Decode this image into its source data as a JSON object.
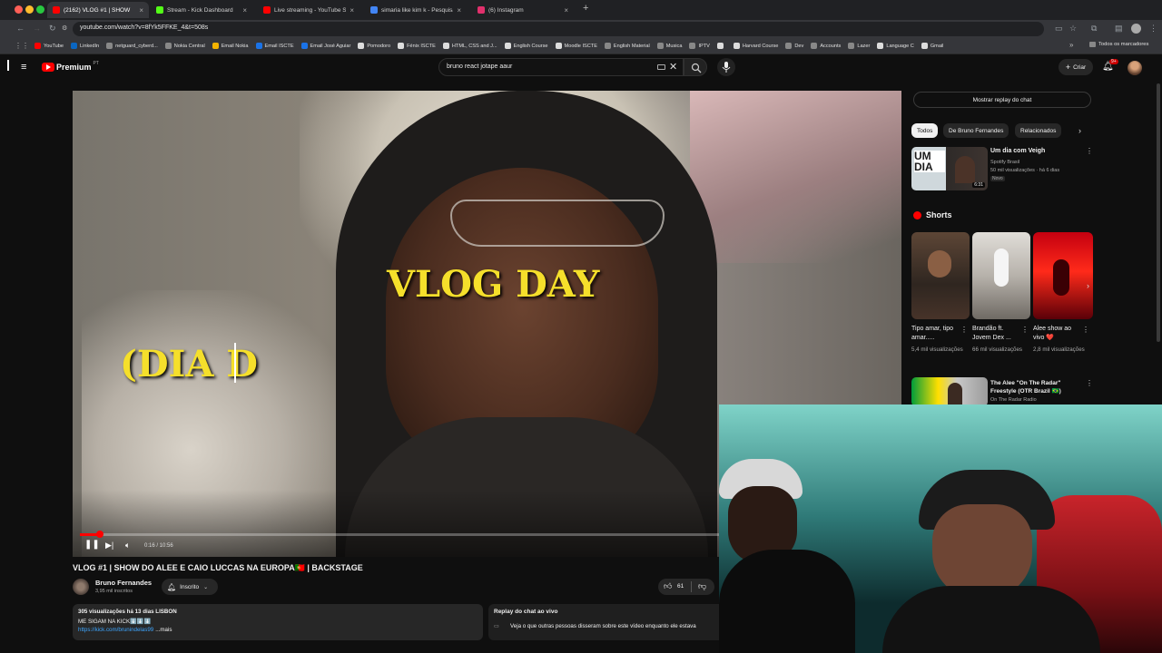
{
  "browser": {
    "tabs": [
      {
        "label": "(2162) VLOG #1 | SHOW",
        "color": "#ff0000",
        "active": true
      },
      {
        "label": "Stream - Kick Dashboard",
        "color": "#53fc18"
      },
      {
        "label": "Live streaming - YouTube St",
        "color": "#ff0000"
      },
      {
        "label": "simaria like kim k - Pesquisa",
        "color": "#4285f4"
      },
      {
        "label": "(6) Instagram",
        "color": "#e1306c"
      }
    ],
    "url": "youtube.com/watch?v=8fYk5FFKE_4&t=508s",
    "bookmarks": [
      {
        "label": "YouTube",
        "color": "#ff0000"
      },
      {
        "label": "LinkedIn",
        "color": "#0a66c2"
      },
      {
        "label": "netguard_cyberd...",
        "color": "#888888"
      },
      {
        "label": "Nokia Central",
        "color": "#888888"
      },
      {
        "label": "Email Nokia",
        "color": "#f4b400"
      },
      {
        "label": "Email ISCTE",
        "color": "#1a73e8"
      },
      {
        "label": "Email José Aguiar",
        "color": "#1a73e8"
      },
      {
        "label": "Pomodoro",
        "color": "#dddddd"
      },
      {
        "label": "Fénix ISCTE",
        "color": "#dddddd"
      },
      {
        "label": "HTML, CSS and J...",
        "color": "#dddddd"
      },
      {
        "label": "English Course",
        "color": "#dddddd"
      },
      {
        "label": "Moodle ISCTE",
        "color": "#dddddd"
      },
      {
        "label": "English Material",
        "color": "#888888"
      },
      {
        "label": "Musica",
        "color": "#888888"
      },
      {
        "label": "IPTV",
        "color": "#888888"
      },
      {
        "label": "",
        "color": "#dddddd"
      },
      {
        "label": "Harvard Course",
        "color": "#dddddd"
      },
      {
        "label": "Dev",
        "color": "#888888"
      },
      {
        "label": "Accounts",
        "color": "#888888"
      },
      {
        "label": "Lazer",
        "color": "#888888"
      },
      {
        "label": "Language C",
        "color": "#dddddd"
      },
      {
        "label": "Gmail",
        "color": "#dddddd"
      }
    ],
    "all_bookmarks": "Todos os marcadores"
  },
  "yt": {
    "logo": "Premium",
    "logo_suffix": "PT",
    "search_value": "bruno react jotape aaur",
    "create_label": "Criar",
    "notif_count": "9+"
  },
  "video": {
    "overlay_main": "VLOG DAY",
    "overlay_side": "(DIA D",
    "time": "0:16 / 10:56",
    "progress": 0.025,
    "title": "VLOG #1 | SHOW DO ALEE E CAIO LUCCAS NA EUROPA🇵🇹 | BACKSTAGE",
    "channel": "Bruno Fernandes",
    "subs": "3,95 mil inscritos",
    "subscribed_label": "Inscrito",
    "likes": "61",
    "desc_stats": "305 visualizações  há 13 dias  LISBON",
    "desc_line2": "ME SIGAM NA KICK⬇️⬇️⬇️",
    "desc_link": "https://kick.com/brunindelas99",
    "desc_more": "...mais",
    "chat_title": "Replay do chat ao vivo",
    "chat_text": "Veja o que outras pessoas disseram sobre este vídeo enquanto ele estava"
  },
  "sidebar": {
    "replay_button": "Mostrar replay do chat",
    "chips": [
      "Todos",
      "De Bruno Fernandes",
      "Relacionados"
    ],
    "rec": {
      "title": "Um dia com Veigh",
      "channel": "Spotify Brasil",
      "meta": "50 mil visualizações · há 6 dias",
      "badge": "Novo",
      "duration": "6:31",
      "thumb_text": "UM DIA"
    },
    "shorts_title": "Shorts",
    "shorts": [
      {
        "title": "Tipo amar, tipo amar.....",
        "views": "5,4 mil visualizações"
      },
      {
        "title": "Brandão ft. Jovem Dex ...",
        "views": "66 mil visualizações"
      },
      {
        "title": "Alee show ao vivo ❤️",
        "views": "2,8 mil visualizações"
      }
    ],
    "rec2": {
      "title": "The Alee \"On The Radar\" Freestyle (OTR Brazil 🇧🇷)",
      "channel": "On The Radar Radio"
    }
  }
}
